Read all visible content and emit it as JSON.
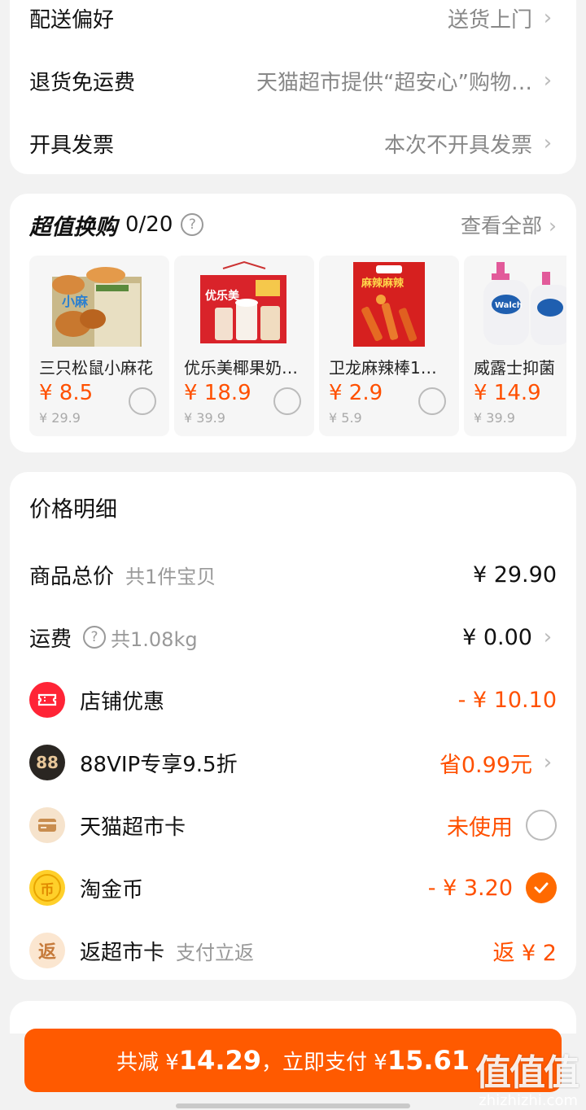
{
  "options": [
    {
      "label": "配送偏好",
      "value": "送货上门"
    },
    {
      "label": "退货免运费",
      "value": "天猫超市提供“超安心”购物…"
    },
    {
      "label": "开具发票",
      "value": "本次不开具发票"
    }
  ],
  "exchange": {
    "title": "超值换购",
    "count": "0/20",
    "view_all": "查看全部",
    "products": [
      {
        "name": "三只松鼠小麻花",
        "price": "¥ 8.5",
        "orig": "¥ 29.9"
      },
      {
        "name": "优乐美椰果奶…",
        "price": "¥ 18.9",
        "orig": "¥ 39.9"
      },
      {
        "name": "卫龙麻辣棒1…",
        "price": "¥ 2.9",
        "orig": "¥ 5.9"
      },
      {
        "name": "威露士抑菌",
        "price": "¥ 14.9",
        "orig": "¥ 39.9"
      }
    ]
  },
  "price_detail": {
    "title": "价格明细",
    "goods": {
      "label": "商品总价",
      "sub": "共1件宝贝",
      "value": "¥ 29.90"
    },
    "shipping": {
      "label": "运费",
      "sub": "共1.08kg",
      "value": "¥ 0.00"
    },
    "store_discount": {
      "label": "店铺优惠",
      "value": "- ¥ 10.10"
    },
    "vip": {
      "label": "88VIP专享9.5折",
      "value": "省0.99元",
      "icon_text": "88"
    },
    "market_card": {
      "label": "天猫超市卡",
      "value": "未使用"
    },
    "coins": {
      "label": "淘金币",
      "value": "- ¥ 3.20",
      "icon_text": "币"
    },
    "cashback": {
      "label": "返超市卡",
      "sub": "支付立返",
      "value": "返 ¥ 2",
      "icon_text": "返"
    }
  },
  "pay": {
    "prefix": "共减 ¥",
    "reduce": "14.29",
    "middle": "，立即支付 ¥",
    "total": "15.61"
  },
  "watermark": {
    "logo": "值值值",
    "url": "zhizhizhi.com"
  },
  "colors": {
    "accent": "#ff5000",
    "button": "#ff5a00",
    "background": "#f2f2f2"
  }
}
